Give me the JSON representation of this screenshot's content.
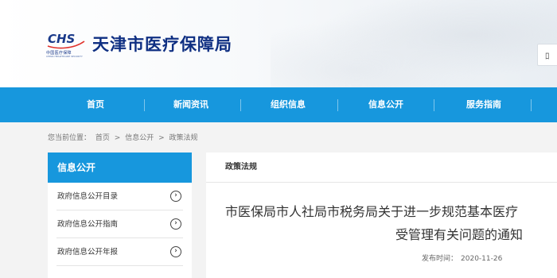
{
  "header": {
    "logo_text": "CHS",
    "logo_caption": "中国医疗保障",
    "logo_caption_en": "CHINA HEALTHCARE SECURITY",
    "site_name": "天津市医疗保障局",
    "search_glyph": "ﾛ"
  },
  "nav": {
    "items": [
      "首页",
      "新闻资讯",
      "组织信息",
      "信息公开",
      "服务指南"
    ]
  },
  "breadcrumb": {
    "prefix": "您当前位置：",
    "items": [
      "首页",
      "信息公开",
      "政策法规"
    ],
    "separator": ">"
  },
  "sidebar": {
    "title": "信息公开",
    "items": [
      {
        "label": "政府信息公开目录"
      },
      {
        "label": "政府信息公开指南"
      },
      {
        "label": "政府信息公开年报"
      }
    ],
    "arrow_glyph": "›"
  },
  "main": {
    "section_title": "政策法规",
    "article": {
      "title_line1": "市医保局市人社局市税务局关于进一步规范基本医疗",
      "title_line2": "受管理有关问题的通知",
      "publish_label": "发布时间：",
      "publish_date": "2020-11-26"
    }
  },
  "colors": {
    "primary": "#1797dd",
    "brand_dark": "#0f2f82",
    "background": "#f3f3f3"
  }
}
